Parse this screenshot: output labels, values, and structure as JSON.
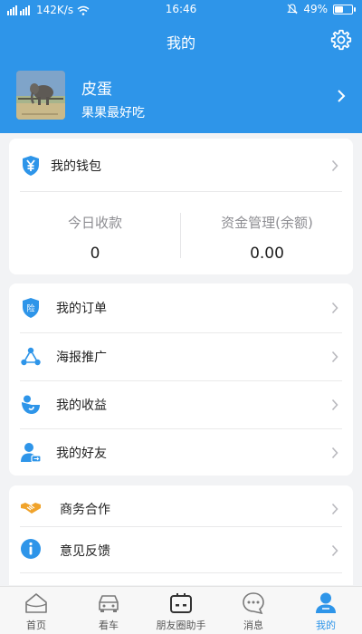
{
  "status_bar": {
    "carrier_icons": " ",
    "speed": "142K/s",
    "time": "16:46",
    "battery": "49%",
    "battery_level": 0.49
  },
  "header": {
    "title": "我的"
  },
  "profile": {
    "name": "皮蛋",
    "motto": "果果最好吃"
  },
  "wallet": {
    "title": "我的钱包",
    "stats": [
      {
        "label": "今日收款",
        "value": "0"
      },
      {
        "label": "资金管理(余额)",
        "value": "0.00"
      }
    ]
  },
  "menu_group_1": [
    {
      "label": "我的订单",
      "icon": "insurance-shield-icon"
    },
    {
      "label": "海报推广",
      "icon": "share-nodes-icon"
    },
    {
      "label": "我的收益",
      "icon": "earnings-icon"
    },
    {
      "label": "我的好友",
      "icon": "friend-icon"
    }
  ],
  "menu_group_2": [
    {
      "label": "商务合作",
      "icon": "handshake-icon"
    },
    {
      "label": "意见反馈",
      "icon": "info-icon"
    }
  ],
  "tabbar": [
    {
      "label": "首页",
      "icon": "home-icon"
    },
    {
      "label": "看车",
      "icon": "car-icon"
    },
    {
      "label": "朋友圈助手",
      "icon": "assistant-icon"
    },
    {
      "label": "消息",
      "icon": "message-icon"
    },
    {
      "label": "我的",
      "icon": "user-icon",
      "active": true
    }
  ],
  "colors": {
    "primary": "#2e95e9",
    "arrow": "#b9b9be",
    "orange": "#f0a32b"
  }
}
